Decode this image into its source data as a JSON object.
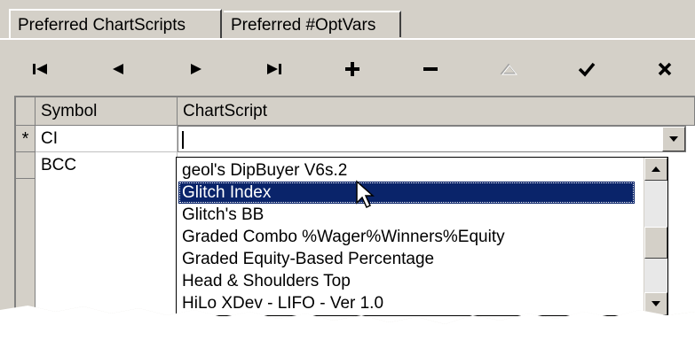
{
  "tabs": [
    {
      "label": "Preferred ChartScripts",
      "active": true
    },
    {
      "label": "Preferred #OptVars",
      "active": false
    }
  ],
  "toolbar": {
    "buttons": [
      {
        "name": "first-record",
        "icon": "skip-first-icon",
        "glyph": "|◄"
      },
      {
        "name": "prior-record",
        "icon": "prev-icon",
        "glyph": "◄"
      },
      {
        "name": "next-record",
        "icon": "next-icon",
        "glyph": "►"
      },
      {
        "name": "last-record",
        "icon": "skip-last-icon",
        "glyph": "►|"
      },
      {
        "name": "insert-record",
        "icon": "plus-icon",
        "glyph": "+"
      },
      {
        "name": "delete-record",
        "icon": "minus-icon",
        "glyph": "−"
      },
      {
        "name": "edit-record",
        "icon": "triangle-up-icon",
        "glyph": "△",
        "disabled": true
      },
      {
        "name": "post-record",
        "icon": "check-icon",
        "glyph": "✓"
      },
      {
        "name": "cancel-record",
        "icon": "close-icon",
        "glyph": "✕"
      }
    ]
  },
  "grid": {
    "columns": [
      "Symbol",
      "ChartScript"
    ],
    "rows": [
      {
        "indicator": "*",
        "symbol": "CI",
        "chartscript": ""
      },
      {
        "indicator": "",
        "symbol": "BCC",
        "chartscript": ""
      }
    ]
  },
  "dropdown": {
    "items": [
      "geol's DipBuyer V6s.2",
      "Glitch Index",
      "Glitch's BB",
      "Graded Combo %Wager%Winners%Equity",
      "Graded Equity-Based Percentage",
      "Head & Shoulders Top",
      "HiLo XDev - LIFO - Ver 1.0"
    ],
    "selected_index": 1
  },
  "colors": {
    "face": "#d4d0c8",
    "highlight": "#0a246a"
  }
}
